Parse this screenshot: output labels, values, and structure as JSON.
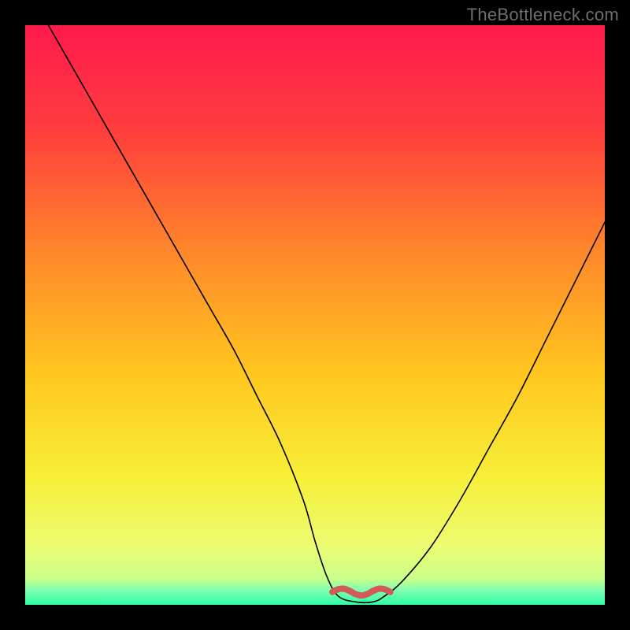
{
  "watermark": "TheBottleneck.com",
  "chart_data": {
    "type": "line",
    "title": "",
    "xlabel": "",
    "ylabel": "",
    "xlim": [
      0,
      100
    ],
    "ylim": [
      0,
      100
    ],
    "grid": false,
    "series": [
      {
        "name": "curve",
        "color": "#000000",
        "x": [
          4,
          8,
          12,
          16,
          20,
          24,
          28,
          32,
          36,
          40,
          44,
          48,
          50,
          52,
          54,
          57,
          60,
          62,
          65,
          70,
          75,
          80,
          85,
          90,
          95,
          100
        ],
        "y": [
          100,
          93,
          86,
          79,
          72,
          65,
          58,
          51,
          44,
          36,
          28,
          18,
          11,
          5,
          1.5,
          0.5,
          0.5,
          1.5,
          4,
          10,
          18,
          27,
          36,
          46,
          56,
          66
        ]
      },
      {
        "name": "highlight-band",
        "color": "#d35a56",
        "x": [
          53,
          63
        ],
        "y": [
          2.2,
          2.2
        ]
      }
    ],
    "background_gradient": {
      "stops": [
        {
          "offset": 0.0,
          "color": "#ff1a4d"
        },
        {
          "offset": 0.18,
          "color": "#ff3d3d"
        },
        {
          "offset": 0.4,
          "color": "#ff8a2a"
        },
        {
          "offset": 0.6,
          "color": "#ffc61e"
        },
        {
          "offset": 0.78,
          "color": "#f7ef38"
        },
        {
          "offset": 0.9,
          "color": "#ecfc72"
        },
        {
          "offset": 0.955,
          "color": "#c9ff8a"
        },
        {
          "offset": 0.975,
          "color": "#7fffb0"
        },
        {
          "offset": 1.0,
          "color": "#2bffa8"
        }
      ]
    }
  }
}
